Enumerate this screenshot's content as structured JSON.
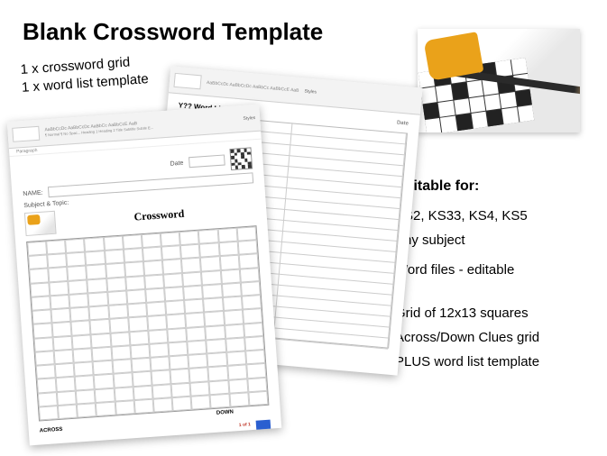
{
  "title": "Blank Crossword Template",
  "subtitle_line1": "1 x crossword grid",
  "subtitle_line2": "1 x word list template",
  "doc_front": {
    "label_subject": "Subject & Topic:",
    "label_name": "NAME:",
    "label_date": "Date",
    "heading": "Crossword",
    "across": "ACROSS",
    "down": "DOWN",
    "page_indicator": "1 of 1"
  },
  "doc_back": {
    "heading": "Y?? Word List",
    "date_label": "Date"
  },
  "ribbon": {
    "style_preview": "AaBbCcDc AaBbCcDc AaBbCc AaBbCcE AaB",
    "style_labels": "¶ Normal ¶ No Spac... Heading 1 Heading 2 Title Subtitle Subtle E...",
    "group": "Styles",
    "paragraph": "Paragraph"
  },
  "sidebar": {
    "title": "Suitable for:",
    "line1": "KS2, KS33, KS4, KS5",
    "line2": "Any subject",
    "line3": "Word files - editable",
    "line4": "Grid of 12x13 squares",
    "line5": "Across/Down Clues grid",
    "line6": "PLUS word list template"
  }
}
